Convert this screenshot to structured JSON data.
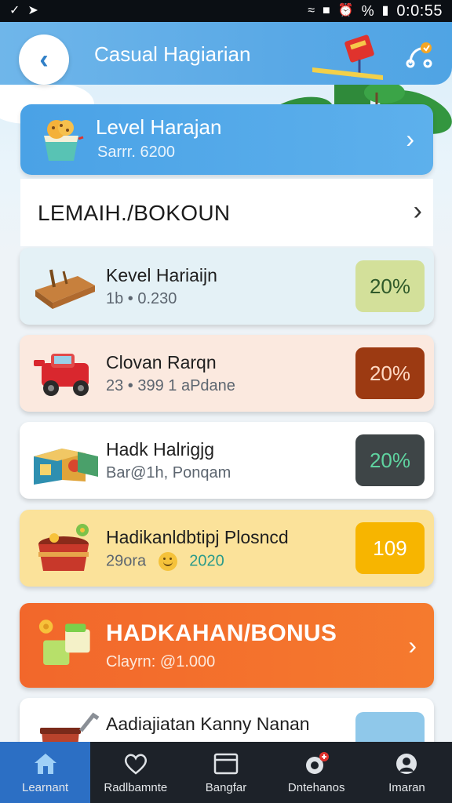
{
  "status_bar": {
    "time": "0:0:55",
    "battery_label": "%"
  },
  "app_bar": {
    "title": "Casual Hagiarian",
    "back_icon": "chevron-left-icon",
    "share_icon": "share-icon"
  },
  "level_card": {
    "title": "Level Harajan",
    "subtitle": "Sarrr. 6200"
  },
  "section": {
    "title": "LEMAIH./BOKOUN"
  },
  "items": [
    {
      "title": "Kevel Hariaijn",
      "subtitle": "1b • 0.230",
      "badge": "20%",
      "bg": "#e4f1f6",
      "badge_bg": "#d3e09a",
      "badge_fg": "#2f5a2a",
      "icon": "wooden-block-icon"
    },
    {
      "title": "Clovan Rarqn",
      "subtitle": "23 • 399 1 aPdane",
      "badge": "20%",
      "bg": "#fbe9df",
      "badge_bg": "#9c3a12",
      "badge_fg": "#ffd9c4",
      "icon": "toy-car-icon"
    },
    {
      "title": "Hadk Halrigjg",
      "subtitle": "Bar@1h, Ponqam",
      "badge": "20%",
      "bg": "#ffffff",
      "badge_bg": "#3e4547",
      "badge_fg": "#5fd3a0",
      "icon": "toy-boxes-icon"
    },
    {
      "title": "Hadikanldbtipj Plosncd",
      "subtitle": "29ora",
      "subtitle2": "2020",
      "badge": "109",
      "bg": "#fbe29a",
      "badge_bg": "#f7b500",
      "badge_fg": "#ffffff",
      "icon": "cooking-pot-icon"
    }
  ],
  "bonus": {
    "title": "HADKAHAN/BONUS",
    "subtitle": "Clayrn: @1.000"
  },
  "partial_card": {
    "title": "Aadiajiatan Kanny Nanan"
  },
  "nav": [
    {
      "label": "Learnant",
      "icon": "home-icon",
      "active": true
    },
    {
      "label": "Radlbamnte",
      "icon": "heart-icon",
      "active": false
    },
    {
      "label": "Bangfar",
      "icon": "browser-icon",
      "active": false
    },
    {
      "label": "Dntehanos",
      "icon": "camera-icon",
      "active": false
    },
    {
      "label": "Imaran",
      "icon": "user-icon",
      "active": false
    }
  ],
  "colors": {
    "accent_blue": "#4fa4e4",
    "bonus_orange": "#f2672b",
    "nav_bg": "#1d2229",
    "nav_active": "#2c6fc4"
  }
}
